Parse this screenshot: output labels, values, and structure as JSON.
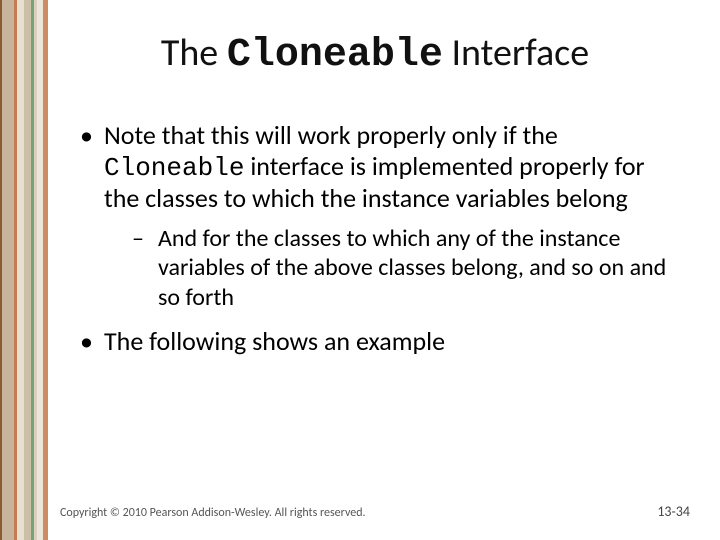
{
  "title": {
    "prefix": "The ",
    "code": "Cloneable",
    "suffix": " Interface"
  },
  "bullets": [
    {
      "segments": [
        {
          "text": "Note that this will work properly only if the ",
          "mono": false
        },
        {
          "text": "Cloneable",
          "mono": true
        },
        {
          "text": " interface is implemented properly for the classes to which the instance variables belong",
          "mono": false
        }
      ],
      "sub": [
        {
          "text": "And for the classes to which any of the instance variables of the above classes belong, and so on and so forth"
        }
      ]
    },
    {
      "segments": [
        {
          "text": "The following shows an example",
          "mono": false
        }
      ],
      "sub": []
    }
  ],
  "footer": {
    "copyright": "Copyright © 2010 Pearson Addison-Wesley. All rights reserved.",
    "page": "13-34"
  }
}
